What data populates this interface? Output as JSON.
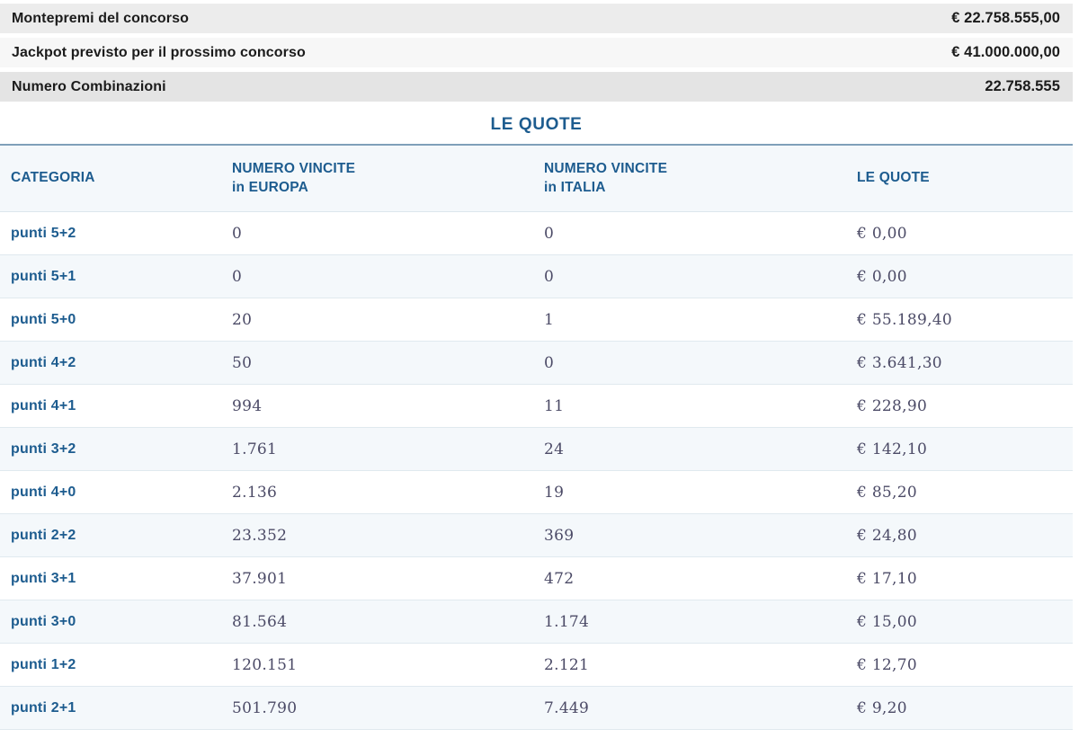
{
  "summary": {
    "rows": [
      {
        "label": "Montepremi del concorso",
        "value": "€ 22.758.555,00"
      },
      {
        "label": "Jackpot previsto per il prossimo concorso",
        "value": "€ 41.000.000,00"
      },
      {
        "label": "Numero Combinazioni",
        "value": "22.758.555"
      }
    ]
  },
  "quotes": {
    "title": "LE QUOTE",
    "columns": [
      "CATEGORIA",
      "NUMERO VINCITE\nin EUROPA",
      "NUMERO VINCITE\nin ITALIA",
      "LE QUOTE"
    ],
    "rows": [
      {
        "category": "punti 5+2",
        "europe": "0",
        "italy": "0",
        "quote": "€ 0,00"
      },
      {
        "category": "punti 5+1",
        "europe": "0",
        "italy": "0",
        "quote": "€ 0,00"
      },
      {
        "category": "punti 5+0",
        "europe": "20",
        "italy": "1",
        "quote": "€ 55.189,40"
      },
      {
        "category": "punti 4+2",
        "europe": "50",
        "italy": "0",
        "quote": "€ 3.641,30"
      },
      {
        "category": "punti 4+1",
        "europe": "994",
        "italy": "11",
        "quote": "€ 228,90"
      },
      {
        "category": "punti 3+2",
        "europe": "1.761",
        "italy": "24",
        "quote": "€ 142,10"
      },
      {
        "category": "punti 4+0",
        "europe": "2.136",
        "italy": "19",
        "quote": "€ 85,20"
      },
      {
        "category": "punti 2+2",
        "europe": "23.352",
        "italy": "369",
        "quote": "€ 24,80"
      },
      {
        "category": "punti 3+1",
        "europe": "37.901",
        "italy": "472",
        "quote": "€ 17,10"
      },
      {
        "category": "punti 3+0",
        "europe": "81.564",
        "italy": "1.174",
        "quote": "€ 15,00"
      },
      {
        "category": "punti 1+2",
        "europe": "120.151",
        "italy": "2.121",
        "quote": "€ 12,70"
      },
      {
        "category": "punti 2+1",
        "europe": "501.790",
        "italy": "7.449",
        "quote": "€ 9,20"
      }
    ]
  },
  "colors": {
    "accent_blue": "#1d5c8f",
    "rule_blue": "#7f9fb9",
    "row_alt_bg": "#f4f8fb",
    "row_separator": "#e0e9ef",
    "number_text": "#4b4a66",
    "summary_bg_1": "#ececec",
    "summary_bg_2": "#f7f7f7",
    "summary_bg_3": "#e4e4e4",
    "summary_text": "#1b1b1b"
  }
}
